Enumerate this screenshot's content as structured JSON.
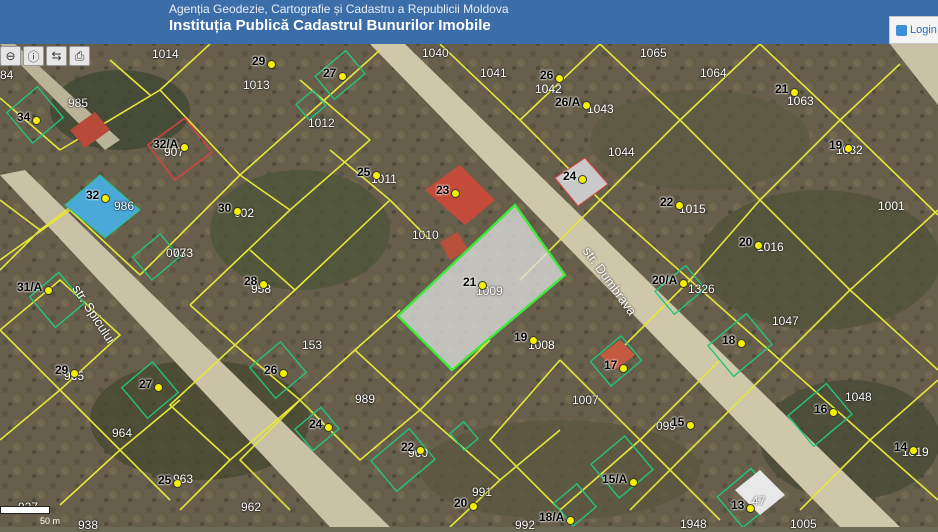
{
  "header": {
    "agency": "Agenția Geodezie, Cartografie și Cadastru a Republicii Moldova",
    "institution": "Instituția Publică Cadastrul Bunurilor Imobile",
    "login_label": "Login"
  },
  "toolbar": {
    "tools": [
      "zoom-out-icon",
      "info-icon",
      "measure-icon",
      "print-icon"
    ]
  },
  "streets": {
    "spicului": "str. Spicului",
    "dumbrava": "str. Dumbrava"
  },
  "scale": {
    "label": "50 m"
  },
  "colors": {
    "parcel": "#e6e63a",
    "selected": "#3ee83a",
    "building": "#23c47a",
    "header": "#3b6ea8"
  },
  "parcels": [
    {
      "id": "p1014",
      "label": "1014"
    },
    {
      "id": "p1013",
      "label": "1013"
    },
    {
      "id": "p1012",
      "label": "1012"
    },
    {
      "id": "p1040",
      "label": "1040"
    },
    {
      "id": "p1041",
      "label": "1041"
    },
    {
      "id": "p1065",
      "label": "1065"
    },
    {
      "id": "p1064",
      "label": "1064"
    },
    {
      "id": "p985",
      "label": "985"
    },
    {
      "id": "p986",
      "label": "986"
    },
    {
      "id": "p1010",
      "label": "1010"
    },
    {
      "id": "p1044",
      "label": "1044"
    },
    {
      "id": "p073",
      "label": "073"
    },
    {
      "id": "p1326",
      "label": "1326"
    },
    {
      "id": "p1047",
      "label": "1047"
    },
    {
      "id": "p153",
      "label": "153"
    },
    {
      "id": "p989",
      "label": "989"
    },
    {
      "id": "p964",
      "label": "964"
    },
    {
      "id": "p1007",
      "label": "1007"
    },
    {
      "id": "p1048",
      "label": "1048"
    },
    {
      "id": "p962",
      "label": "962"
    },
    {
      "id": "p991",
      "label": "991"
    },
    {
      "id": "p099",
      "label": "099"
    },
    {
      "id": "p1948",
      "label": "1948"
    },
    {
      "id": "p1005",
      "label": "1005"
    },
    {
      "id": "p938",
      "label": "938"
    },
    {
      "id": "p992",
      "label": "992"
    },
    {
      "id": "p84",
      "label": "84"
    },
    {
      "id": "p927",
      "label": "927"
    }
  ],
  "address_labels": [
    "29",
    "27",
    "34",
    "32/A",
    "26",
    "26/A",
    "21",
    "25",
    "23",
    "24",
    "19",
    "32",
    "30",
    "22",
    "17",
    "20",
    "28",
    "20/A",
    "31/A",
    "18",
    "26",
    "29",
    "27",
    "16",
    "24",
    "15",
    "22",
    "15/A",
    "14",
    "25",
    "20",
    "18/A",
    "13",
    "21",
    "19"
  ],
  "partial_cadastre": [
    "1063",
    "1043",
    "1042",
    "1032",
    "1011",
    "1001",
    "002",
    "1015",
    "1016",
    "1009",
    "1008",
    "958",
    "907",
    "965",
    "960",
    "963",
    "1019",
    "073",
    "47"
  ],
  "house_numbers": [
    "1"
  ]
}
